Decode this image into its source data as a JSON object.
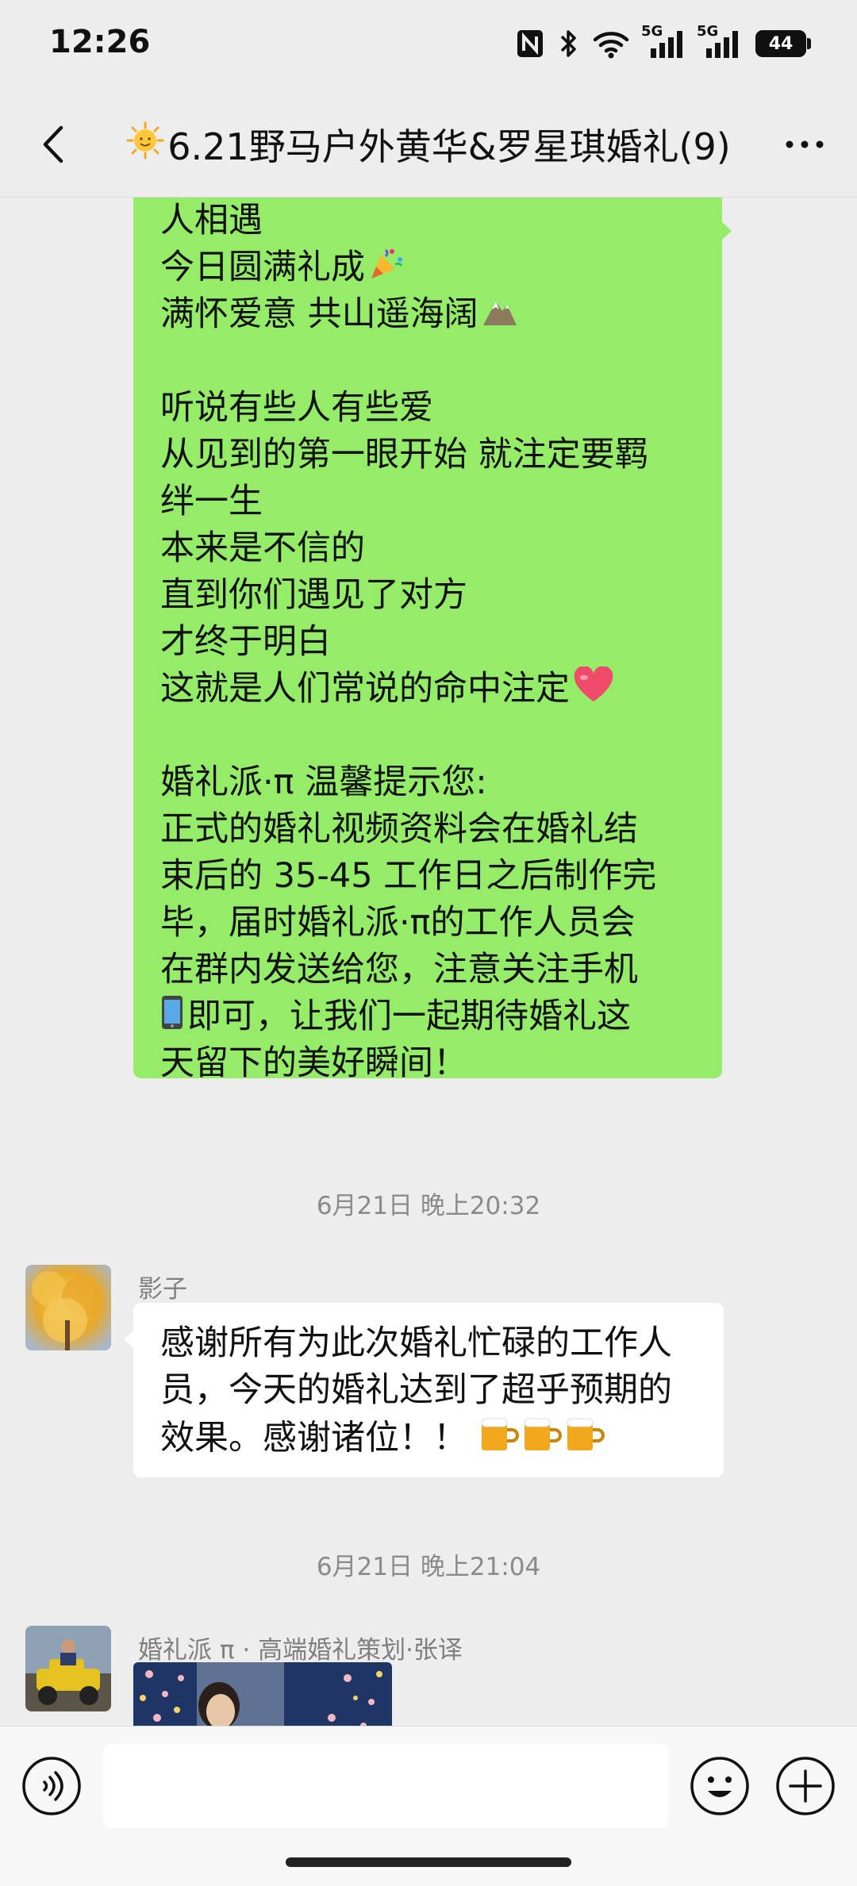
{
  "status_bar": {
    "time": "12:26",
    "network_1": "5G",
    "network_2": "5G",
    "battery": "44",
    "icons": [
      "nfc-icon",
      "bluetooth-icon",
      "wifi-icon",
      "signal-icon",
      "signal-icon",
      "battery-icon"
    ]
  },
  "header": {
    "title": "6.21野马户外黄华&罗星琪婚礼(9)",
    "title_icon": "sun-emoji-icon",
    "back_icon": "chevron-left-icon",
    "more_icon": "more-dots-icon"
  },
  "messages": {
    "green_bubble": {
      "lines": [
        "人相遇",
        "今日圆满礼成",
        "满怀爱意 共山遥海阔",
        "",
        "听说有些人有些爱",
        "从见到的第一眼开始 就注定要羁",
        "绊一生",
        "本来是不信的",
        "直到你们遇见了对方",
        "才终于明白",
        "这就是人们常说的命中注定",
        "",
        "婚礼派·π 温馨提示您:",
        "正式的婚礼视频资料会在婚礼结",
        "束后的 35-45 工作日之后制作完",
        "毕，届时婚礼派·π的工作人员会",
        "在群内发送给您，注意关注手机",
        "即可，让我们一起期待婚礼这",
        "天留下的美好瞬间！"
      ]
    },
    "timestamp_1": "6月21日 晚上20:32",
    "msg_yingzi": {
      "sender": "影子",
      "text": "感谢所有为此次婚礼忙碌的工作人员，今天的婚礼达到了超乎预期的效果。感谢诸位！！"
    },
    "timestamp_2": "6月21日 晚上21:04",
    "msg_planner": {
      "sender": "婚礼派 π · 高端婚礼策划·张译"
    }
  },
  "input_bar": {
    "placeholder": "",
    "voice_icon": "voice-icon",
    "emoji_icon": "emoji-icon",
    "plus_icon": "plus-icon"
  },
  "colors": {
    "background": "#ededed",
    "green_bubble": "#95ec69",
    "white_bubble": "#ffffff",
    "timestamp": "#8a8a8a"
  }
}
